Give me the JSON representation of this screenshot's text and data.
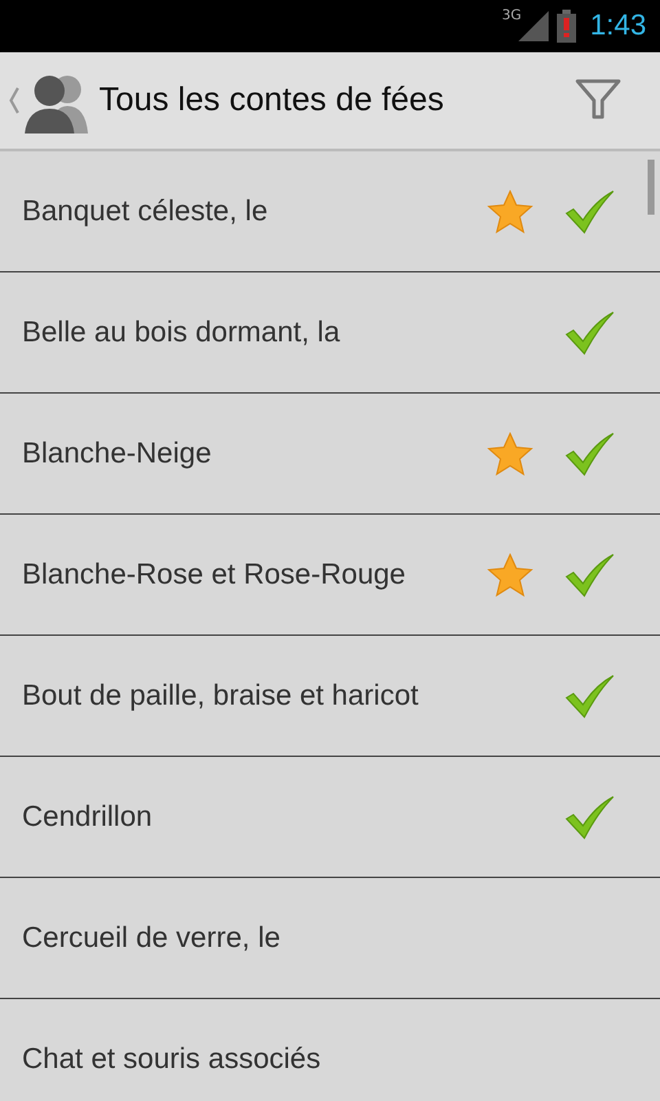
{
  "status_bar": {
    "network": "3G",
    "time": "1:43"
  },
  "action_bar": {
    "title": "Tous les contes de fées"
  },
  "tales": [
    {
      "title": "Banquet céleste, le",
      "favorite": true,
      "read": true
    },
    {
      "title": "Belle au bois dormant, la",
      "favorite": false,
      "read": true
    },
    {
      "title": "Blanche-Neige",
      "favorite": true,
      "read": true
    },
    {
      "title": "Blanche-Rose et Rose-Rouge",
      "favorite": true,
      "read": true
    },
    {
      "title": "Bout de paille, braise et haricot",
      "favorite": false,
      "read": true
    },
    {
      "title": "Cendrillon",
      "favorite": false,
      "read": true
    },
    {
      "title": "Cercueil de verre, le",
      "favorite": false,
      "read": false
    },
    {
      "title": "Chat et souris associés",
      "favorite": false,
      "read": false
    }
  ]
}
